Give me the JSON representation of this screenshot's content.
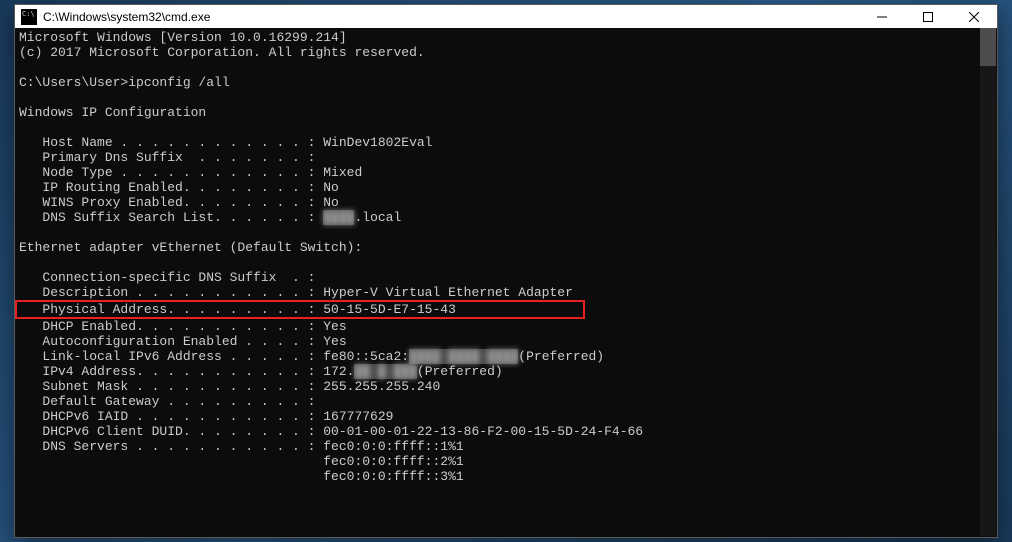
{
  "window": {
    "title": "C:\\Windows\\system32\\cmd.exe"
  },
  "lines": {
    "l0": "Microsoft Windows [Version 10.0.16299.214]",
    "l1": "(c) 2017 Microsoft Corporation. All rights reserved.",
    "l2": "",
    "l3": "C:\\Users\\User>ipconfig /all",
    "l4": "",
    "l5": "Windows IP Configuration",
    "l6": "",
    "l7": "   Host Name . . . . . . . . . . . . : WinDev1802Eval",
    "l8": "   Primary Dns Suffix  . . . . . . . :",
    "l9": "   Node Type . . . . . . . . . . . . : Mixed",
    "l10": "   IP Routing Enabled. . . . . . . . : No",
    "l11": "   WINS Proxy Enabled. . . . . . . . : No",
    "l12a": "   DNS Suffix Search List. . . . . . : ",
    "l12b": "████",
    "l12c": ".local",
    "l13": "",
    "l14": "Ethernet adapter vEthernet (Default Switch):",
    "l15": "",
    "l16": "   Connection-specific DNS Suffix  . :",
    "l17": "   Description . . . . . . . . . . . : Hyper-V Virtual Ethernet Adapter",
    "l18": "   Physical Address. . . . . . . . . : 50-15-5D-E7-15-43",
    "l19": "   DHCP Enabled. . . . . . . . . . . : Yes",
    "l20": "   Autoconfiguration Enabled . . . . : Yes",
    "l21a": "   Link-local IPv6 Address . . . . . : fe80::5ca2:",
    "l21b": "████:████:████",
    "l21c": "(Preferred)",
    "l22a": "   IPv4 Address. . . . . . . . . . . : 172.",
    "l22b": "██.█.███",
    "l22c": "(Preferred)",
    "l23": "   Subnet Mask . . . . . . . . . . . : 255.255.255.240",
    "l24": "   Default Gateway . . . . . . . . . :",
    "l25": "   DHCPv6 IAID . . . . . . . . . . . : 167777629",
    "l26": "   DHCPv6 Client DUID. . . . . . . . : 00-01-00-01-22-13-86-F2-00-15-5D-24-F4-66",
    "l27": "   DNS Servers . . . . . . . . . . . : fec0:0:0:ffff::1%1",
    "l28": "                                       fec0:0:0:ffff::2%1",
    "l29": "                                       fec0:0:0:ffff::3%1"
  }
}
